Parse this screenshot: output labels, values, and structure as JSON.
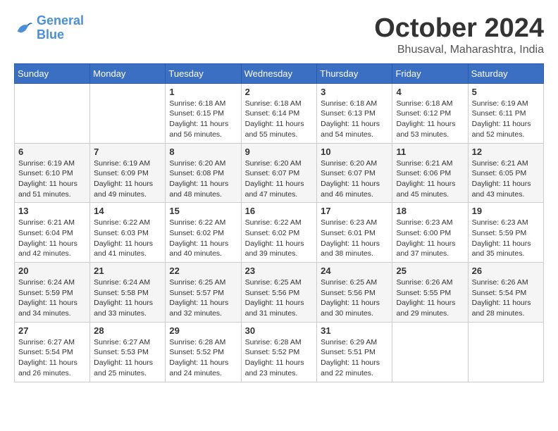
{
  "logo": {
    "line1": "General",
    "line2": "Blue"
  },
  "title": "October 2024",
  "location": "Bhusaval, Maharashtra, India",
  "days_of_week": [
    "Sunday",
    "Monday",
    "Tuesday",
    "Wednesday",
    "Thursday",
    "Friday",
    "Saturday"
  ],
  "weeks": [
    [
      {
        "day": "",
        "info": ""
      },
      {
        "day": "",
        "info": ""
      },
      {
        "day": "1",
        "info": "Sunrise: 6:18 AM\nSunset: 6:15 PM\nDaylight: 11 hours and 56 minutes."
      },
      {
        "day": "2",
        "info": "Sunrise: 6:18 AM\nSunset: 6:14 PM\nDaylight: 11 hours and 55 minutes."
      },
      {
        "day": "3",
        "info": "Sunrise: 6:18 AM\nSunset: 6:13 PM\nDaylight: 11 hours and 54 minutes."
      },
      {
        "day": "4",
        "info": "Sunrise: 6:18 AM\nSunset: 6:12 PM\nDaylight: 11 hours and 53 minutes."
      },
      {
        "day": "5",
        "info": "Sunrise: 6:19 AM\nSunset: 6:11 PM\nDaylight: 11 hours and 52 minutes."
      }
    ],
    [
      {
        "day": "6",
        "info": "Sunrise: 6:19 AM\nSunset: 6:10 PM\nDaylight: 11 hours and 51 minutes."
      },
      {
        "day": "7",
        "info": "Sunrise: 6:19 AM\nSunset: 6:09 PM\nDaylight: 11 hours and 49 minutes."
      },
      {
        "day": "8",
        "info": "Sunrise: 6:20 AM\nSunset: 6:08 PM\nDaylight: 11 hours and 48 minutes."
      },
      {
        "day": "9",
        "info": "Sunrise: 6:20 AM\nSunset: 6:07 PM\nDaylight: 11 hours and 47 minutes."
      },
      {
        "day": "10",
        "info": "Sunrise: 6:20 AM\nSunset: 6:07 PM\nDaylight: 11 hours and 46 minutes."
      },
      {
        "day": "11",
        "info": "Sunrise: 6:21 AM\nSunset: 6:06 PM\nDaylight: 11 hours and 45 minutes."
      },
      {
        "day": "12",
        "info": "Sunrise: 6:21 AM\nSunset: 6:05 PM\nDaylight: 11 hours and 43 minutes."
      }
    ],
    [
      {
        "day": "13",
        "info": "Sunrise: 6:21 AM\nSunset: 6:04 PM\nDaylight: 11 hours and 42 minutes."
      },
      {
        "day": "14",
        "info": "Sunrise: 6:22 AM\nSunset: 6:03 PM\nDaylight: 11 hours and 41 minutes."
      },
      {
        "day": "15",
        "info": "Sunrise: 6:22 AM\nSunset: 6:02 PM\nDaylight: 11 hours and 40 minutes."
      },
      {
        "day": "16",
        "info": "Sunrise: 6:22 AM\nSunset: 6:02 PM\nDaylight: 11 hours and 39 minutes."
      },
      {
        "day": "17",
        "info": "Sunrise: 6:23 AM\nSunset: 6:01 PM\nDaylight: 11 hours and 38 minutes."
      },
      {
        "day": "18",
        "info": "Sunrise: 6:23 AM\nSunset: 6:00 PM\nDaylight: 11 hours and 37 minutes."
      },
      {
        "day": "19",
        "info": "Sunrise: 6:23 AM\nSunset: 5:59 PM\nDaylight: 11 hours and 35 minutes."
      }
    ],
    [
      {
        "day": "20",
        "info": "Sunrise: 6:24 AM\nSunset: 5:59 PM\nDaylight: 11 hours and 34 minutes."
      },
      {
        "day": "21",
        "info": "Sunrise: 6:24 AM\nSunset: 5:58 PM\nDaylight: 11 hours and 33 minutes."
      },
      {
        "day": "22",
        "info": "Sunrise: 6:25 AM\nSunset: 5:57 PM\nDaylight: 11 hours and 32 minutes."
      },
      {
        "day": "23",
        "info": "Sunrise: 6:25 AM\nSunset: 5:56 PM\nDaylight: 11 hours and 31 minutes."
      },
      {
        "day": "24",
        "info": "Sunrise: 6:25 AM\nSunset: 5:56 PM\nDaylight: 11 hours and 30 minutes."
      },
      {
        "day": "25",
        "info": "Sunrise: 6:26 AM\nSunset: 5:55 PM\nDaylight: 11 hours and 29 minutes."
      },
      {
        "day": "26",
        "info": "Sunrise: 6:26 AM\nSunset: 5:54 PM\nDaylight: 11 hours and 28 minutes."
      }
    ],
    [
      {
        "day": "27",
        "info": "Sunrise: 6:27 AM\nSunset: 5:54 PM\nDaylight: 11 hours and 26 minutes."
      },
      {
        "day": "28",
        "info": "Sunrise: 6:27 AM\nSunset: 5:53 PM\nDaylight: 11 hours and 25 minutes."
      },
      {
        "day": "29",
        "info": "Sunrise: 6:28 AM\nSunset: 5:52 PM\nDaylight: 11 hours and 24 minutes."
      },
      {
        "day": "30",
        "info": "Sunrise: 6:28 AM\nSunset: 5:52 PM\nDaylight: 11 hours and 23 minutes."
      },
      {
        "day": "31",
        "info": "Sunrise: 6:29 AM\nSunset: 5:51 PM\nDaylight: 11 hours and 22 minutes."
      },
      {
        "day": "",
        "info": ""
      },
      {
        "day": "",
        "info": ""
      }
    ]
  ]
}
